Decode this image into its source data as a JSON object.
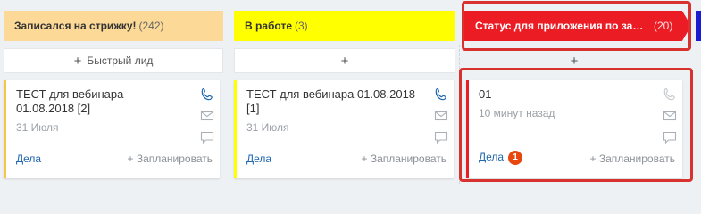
{
  "columns": [
    {
      "stage_name": "Записался на стрижку!",
      "stage_count": "(242)",
      "stage_color": "#fcd996",
      "add_label": "Быстрый лид",
      "card": {
        "title": "ТЕСТ для вебинара 01.08.2018 [2]",
        "date": "31 Июля",
        "deals_label": "Дела",
        "plan_label": "+ Запланировать",
        "strip_color": "#f7c54b"
      }
    },
    {
      "stage_name": "В работе",
      "stage_count": "(3)",
      "stage_color": "#ffff00",
      "add_label": "",
      "card": {
        "title": "ТЕСТ для вебинара 01.08.2018 [1]",
        "date": "31 Июля",
        "deals_label": "Дела",
        "plan_label": "+ Запланировать",
        "strip_color": "#ffff00"
      }
    },
    {
      "stage_name": "Статус для приложения по зап...",
      "stage_count": "(20)",
      "stage_color": "#ec1c24",
      "add_label": "",
      "card": {
        "title": "01",
        "date": "10 минут назад",
        "deals_label": "Дела",
        "deals_badge": "1",
        "plan_label": "+ Запланировать",
        "strip_color": "#ec1c24"
      }
    }
  ],
  "icons": {
    "phone": "phone-icon",
    "mail": "mail-icon",
    "chat": "chat-icon"
  },
  "accent": {
    "highlight": "#d8322f",
    "link": "#2067b0",
    "badge": "#e8470f"
  }
}
